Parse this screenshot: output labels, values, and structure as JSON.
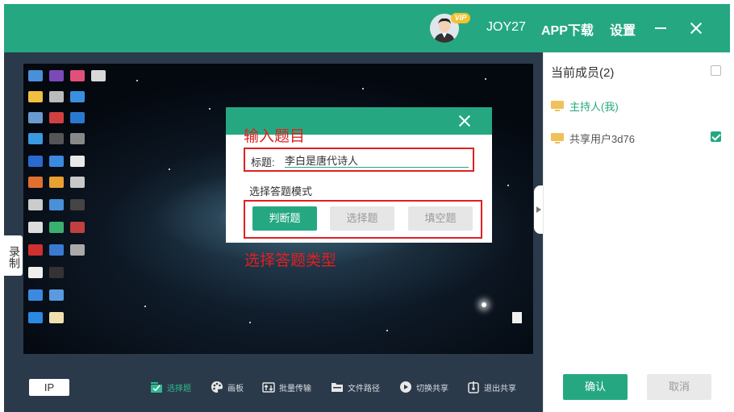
{
  "header": {
    "vip_badge": "VIP",
    "username": "JOY27",
    "app_download": "APP下载",
    "settings": "设置"
  },
  "side": {
    "record_label": "录制"
  },
  "dialog": {
    "title_label": "标题:",
    "title_value": "李白是唐代诗人",
    "mode_label": "选择答题模式",
    "modes": [
      {
        "label": "判断题",
        "active": true
      },
      {
        "label": "选择题",
        "active": false
      },
      {
        "label": "填空题",
        "active": false
      }
    ]
  },
  "annotations": {
    "input_title": "输入题目",
    "choose_type": "选择答题类型"
  },
  "toolbar": {
    "ip": "IP",
    "items": [
      {
        "label": "选择题",
        "icon": "quiz-icon",
        "active": true
      },
      {
        "label": "画板",
        "icon": "palette-icon"
      },
      {
        "label": "批量传输",
        "icon": "transfer-icon"
      },
      {
        "label": "文件路径",
        "icon": "folder-icon"
      },
      {
        "label": "切换共享",
        "icon": "switch-icon"
      },
      {
        "label": "退出共享",
        "icon": "exit-icon"
      }
    ]
  },
  "panel": {
    "members_title": "当前成员(2)",
    "members": [
      {
        "label": "主持人(我)",
        "checked": false
      },
      {
        "label": "共享用户3d76",
        "checked": true
      }
    ],
    "confirm": "确认",
    "cancel": "取消"
  },
  "colors": {
    "accent": "#25a882",
    "toolbar_bg": "#2b3a4a",
    "annotation": "#e02020"
  }
}
